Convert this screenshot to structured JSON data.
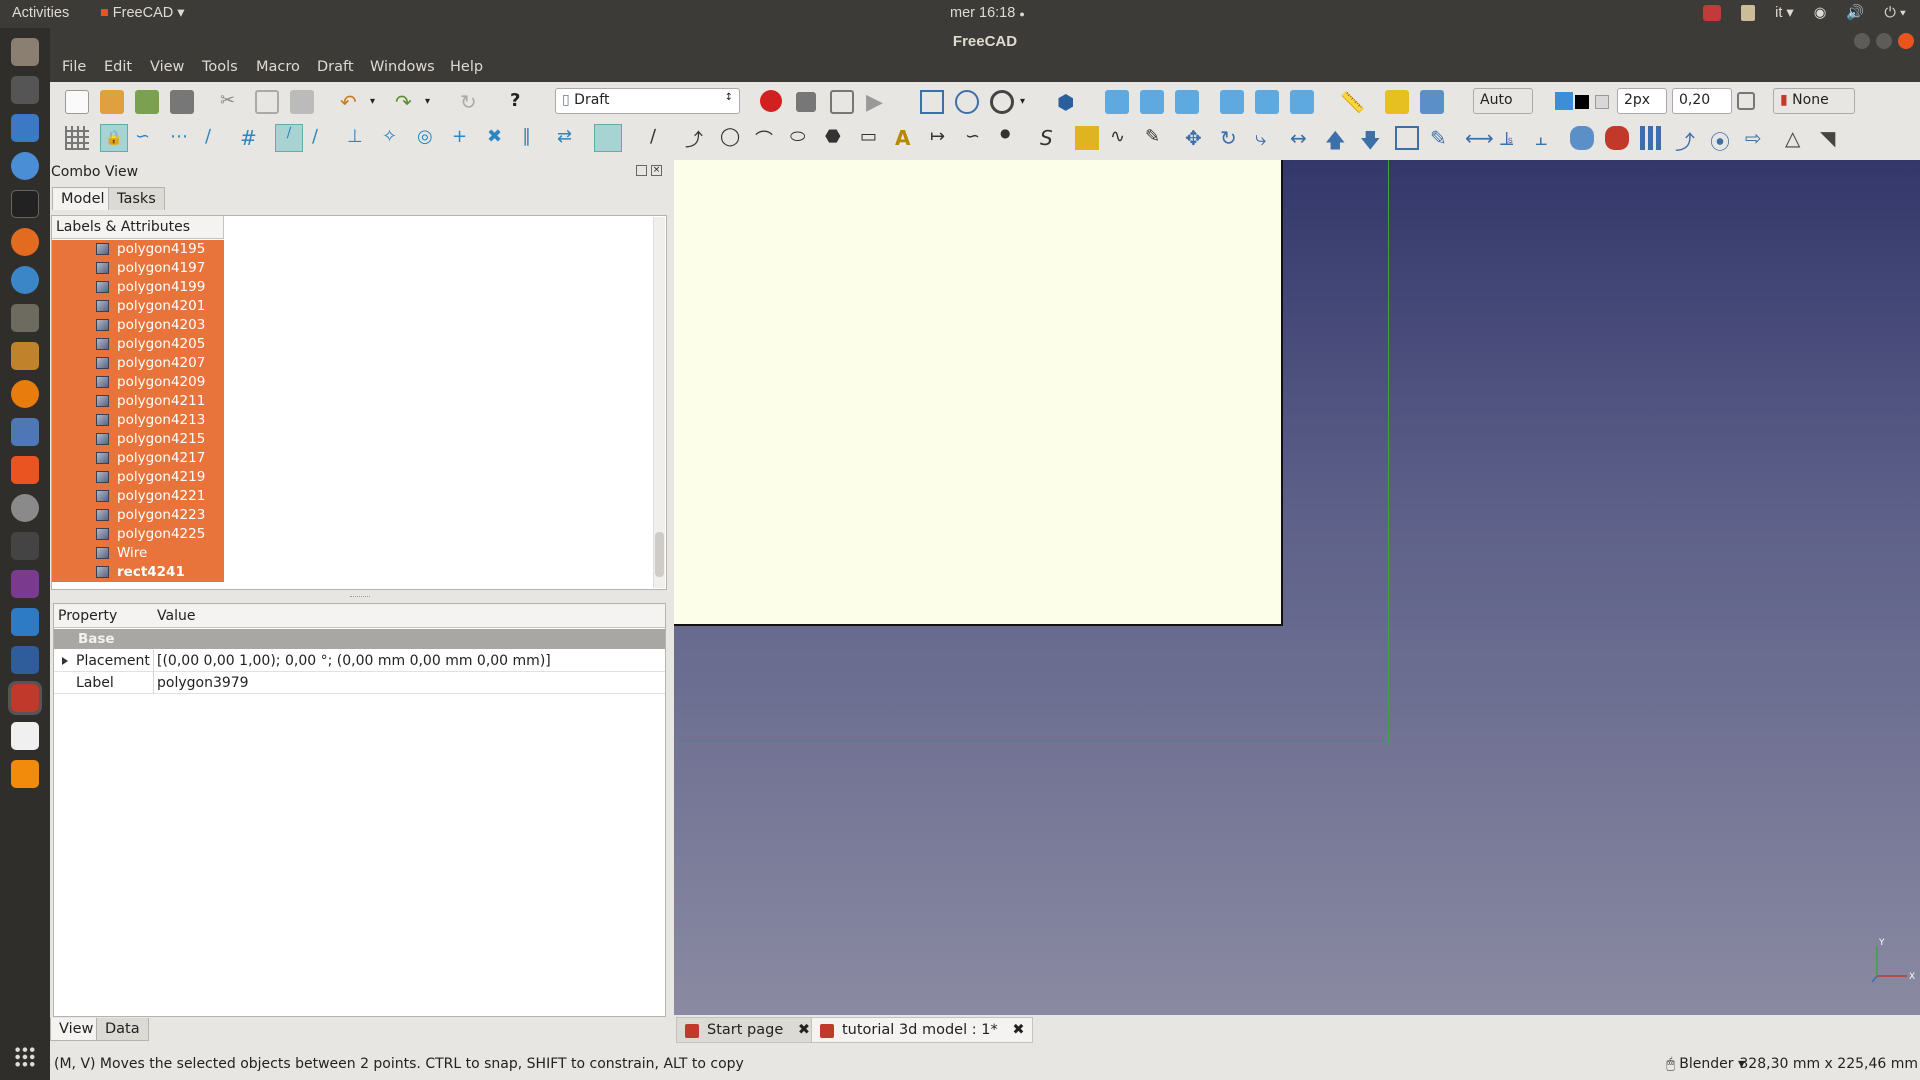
{
  "topbar": {
    "activities": "Activities",
    "app": "FreeCAD",
    "clock": "mer 16:18",
    "lang": "it"
  },
  "window": {
    "title": "FreeCAD"
  },
  "menu": [
    "File",
    "Edit",
    "View",
    "Tools",
    "Macro",
    "Draft",
    "Windows",
    "Help"
  ],
  "toolbar": {
    "workbench": "Draft",
    "auto": "Auto",
    "linewidth": "2px",
    "fontsize": "0,20",
    "none": "None"
  },
  "combo": {
    "title": "Combo View",
    "tabs": [
      "Model",
      "Tasks"
    ],
    "tree_header": "Labels & Attributes",
    "tree_items": [
      "polygon4195",
      "polygon4197",
      "polygon4199",
      "polygon4201",
      "polygon4203",
      "polygon4205",
      "polygon4207",
      "polygon4209",
      "polygon4211",
      "polygon4213",
      "polygon4215",
      "polygon4217",
      "polygon4219",
      "polygon4221",
      "polygon4223",
      "polygon4225",
      "Wire",
      "rect4241"
    ],
    "props": {
      "col_property": "Property",
      "col_value": "Value",
      "group": "Base",
      "placement_name": "Placement",
      "placement_value": "[(0,00 0,00 1,00); 0,00 °; (0,00 mm  0,00 mm  0,00 mm)]",
      "label_name": "Label",
      "label_value": "polygon3979"
    },
    "bottom_tabs": [
      "View",
      "Data"
    ]
  },
  "doc_tabs": [
    {
      "label": "Start page"
    },
    {
      "label": "tutorial 3d model : 1*"
    }
  ],
  "axis": {
    "y": "Y",
    "x": "X"
  },
  "status": {
    "message": "(M, V) Moves the selected objects between 2 points. CTRL to snap, SHIFT to constrain, ALT to copy",
    "nav_style": "Blender",
    "dimensions": "328,30 mm x 225,46 mm"
  },
  "colors": {
    "selection": "#e8743b",
    "chrome": "#3c3b37",
    "sheet": "#fdfee9",
    "construction_line": "#3ea33e"
  }
}
